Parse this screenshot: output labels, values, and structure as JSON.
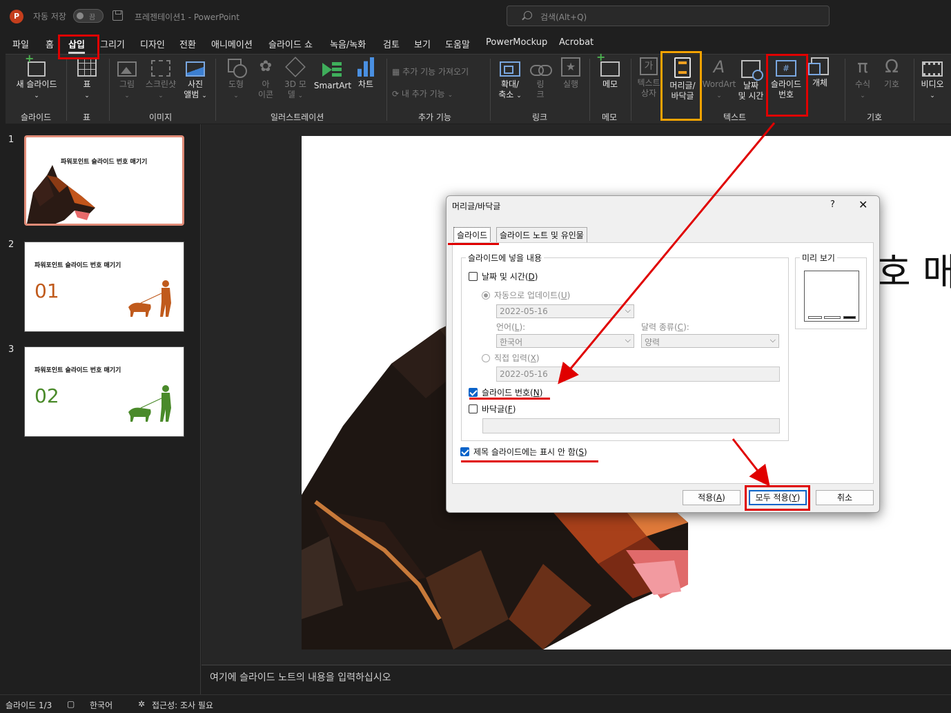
{
  "titlebar": {
    "logo": "P",
    "autosave_label": "자동 저장",
    "autosave_state": "끔",
    "doc_title": "프레젠테이션1  -  PowerPoint",
    "search_placeholder": "검색(Alt+Q)"
  },
  "menu": {
    "tabs": [
      "파일",
      "홈",
      "삽입",
      "그리기",
      "디자인",
      "전환",
      "애니메이션",
      "슬라이드 쇼",
      "녹음/녹화",
      "검토",
      "보기",
      "도움말",
      "PowerMockup",
      "Acrobat"
    ],
    "active": "삽입"
  },
  "ribbon": {
    "new_slide": "새 슬라이드",
    "table": "표",
    "picture": "그림",
    "screenshot": "스크린샷",
    "photo_album": [
      "사진",
      "앨범"
    ],
    "shapes": "도형",
    "icons": [
      "아",
      "이콘"
    ],
    "models3d": [
      "3D 모",
      "델"
    ],
    "smartart": "SmartArt",
    "chart": "차트",
    "get_addins": "추가 기능 가져오기",
    "my_addins": "내 추가 기능",
    "zoom": [
      "확대/",
      "축소"
    ],
    "link": [
      "링",
      "크"
    ],
    "action": "실행",
    "memo": "메모",
    "textbox": [
      "텍스트",
      "상자"
    ],
    "header_footer": [
      "머리글/",
      "바닥글"
    ],
    "wordart": "WordArt",
    "datetime": [
      "날짜",
      "및 시간"
    ],
    "slide_number": [
      "슬라이드",
      "번호"
    ],
    "object": "개체",
    "equation": "수식",
    "symbol": "기호",
    "video": "비디오",
    "groups": {
      "slides": "슬라이드",
      "tables": "표",
      "images": "이미지",
      "illustrations": "일러스트레이션",
      "addins": "추가 기능",
      "links": "링크",
      "comments": "메모",
      "text": "텍스트",
      "symbols": "기호"
    }
  },
  "thumbnails": [
    {
      "num": "1",
      "title": "파워포인트 슬라이드 번호 매기기",
      "big": ""
    },
    {
      "num": "2",
      "title": "파워포인트 슬라이드 번호 매기기",
      "big": "01"
    },
    {
      "num": "3",
      "title": "파워포인트 슬라이드 번호 매기기",
      "big": "02"
    }
  ],
  "slide": {
    "title_peek": "호 매기"
  },
  "notes": {
    "placeholder": "여기에 슬라이드 노트의 내용을 입력하십시오"
  },
  "status": {
    "slide_count": "슬라이드 1/3",
    "language": "한국어",
    "accessibility": "접근성: 조사 필요"
  },
  "dialog": {
    "title": "머리글/바닥글",
    "help": "?",
    "close": "✕",
    "tab_slide": "슬라이드",
    "tab_notes": "슬라이드 노트 및 유인물",
    "group_include": "슬라이드에 넣을 내용",
    "date_time": "날짜 및 시간(",
    "date_time_key": "D",
    "auto_update": "자동으로 업데이트(",
    "auto_update_key": "U",
    "auto_date": "2022-05-16",
    "language_label": "언어(",
    "language_key": "L",
    "language_value": "한국어",
    "calendar_label": "달력 종류(",
    "calendar_key": "C",
    "calendar_value": "양력",
    "fixed": "직접 입력(",
    "fixed_key": "X",
    "fixed_date": "2022-05-16",
    "slide_number": "슬라이드 번호(",
    "slide_number_key": "N",
    "footer": "바닥글(",
    "footer_key": "F",
    "dont_show_title": "제목 슬라이드에는 표시 안 함(",
    "dont_show_title_key": "S",
    "preview": "미리 보기",
    "apply": "적용(",
    "apply_key": "A",
    "apply_all": "모두 적용(",
    "apply_all_key": "Y",
    "cancel": "취소"
  },
  "colors": {
    "annotation_red": "#e00000",
    "annotation_orange": "#f5a300",
    "checkbox_blue": "#0a63c9",
    "thumb2_accent": "#c05a1c",
    "thumb3_accent": "#4a8a2a"
  }
}
